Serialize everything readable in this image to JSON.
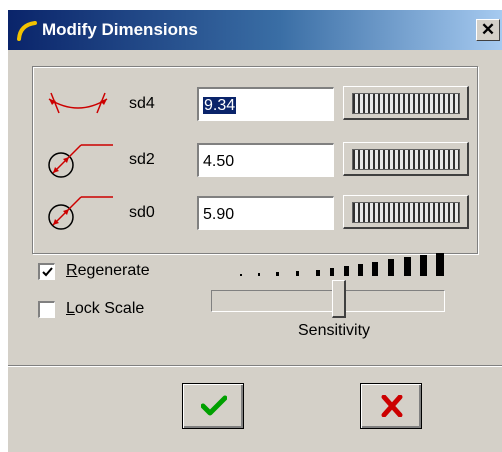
{
  "window": {
    "title": "Modify Dimensions",
    "close_symbol": "✕"
  },
  "dimensions": [
    {
      "label": "sd4",
      "value": "9.34",
      "icon": "angle-dimension-icon",
      "selected": true
    },
    {
      "label": "sd2",
      "value": "4.50",
      "icon": "diameter-dimension-icon",
      "selected": false
    },
    {
      "label": "sd0",
      "value": "5.90",
      "icon": "diameter-dimension-icon",
      "selected": false
    }
  ],
  "options": {
    "regenerate": {
      "label_first": "R",
      "label_rest": "egenerate",
      "checked": true
    },
    "lock_scale": {
      "label_first": "L",
      "label_rest": "ock Scale",
      "checked": false
    }
  },
  "sensitivity": {
    "label": "Sensitivity",
    "level": 0.55
  },
  "buttons": {
    "ok": "accept-checkmark-icon",
    "cancel": "cancel-x-icon"
  },
  "colors": {
    "accent_red": "#cc0000",
    "ok_green": "#00a000",
    "title_start": "#0a246a",
    "title_end": "#a6caf0"
  }
}
